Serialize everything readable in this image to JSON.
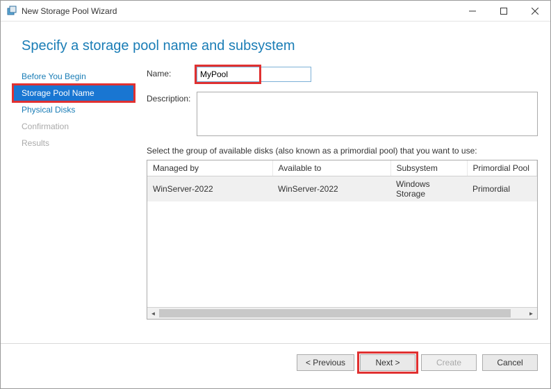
{
  "window": {
    "title": "New Storage Pool Wizard"
  },
  "heading": "Specify a storage pool name and subsystem",
  "sidebar": {
    "steps": [
      {
        "label": "Before You Begin"
      },
      {
        "label": "Storage Pool Name"
      },
      {
        "label": "Physical Disks"
      },
      {
        "label": "Confirmation"
      },
      {
        "label": "Results"
      }
    ]
  },
  "form": {
    "name_label": "Name:",
    "name_value": "MyPool",
    "description_label": "Description:",
    "description_value": "",
    "instruction": "Select the group of available disks (also known as a primordial pool) that you want to use:"
  },
  "table": {
    "headers": {
      "managed_by": "Managed by",
      "available_to": "Available to",
      "subsystem": "Subsystem",
      "primordial_pool": "Primordial Pool"
    },
    "rows": [
      {
        "managed_by": "WinServer-2022",
        "available_to": "WinServer-2022",
        "subsystem": "Windows Storage",
        "primordial_pool": "Primordial"
      }
    ]
  },
  "footer": {
    "previous": "< Previous",
    "next": "Next >",
    "create": "Create",
    "cancel": "Cancel"
  }
}
